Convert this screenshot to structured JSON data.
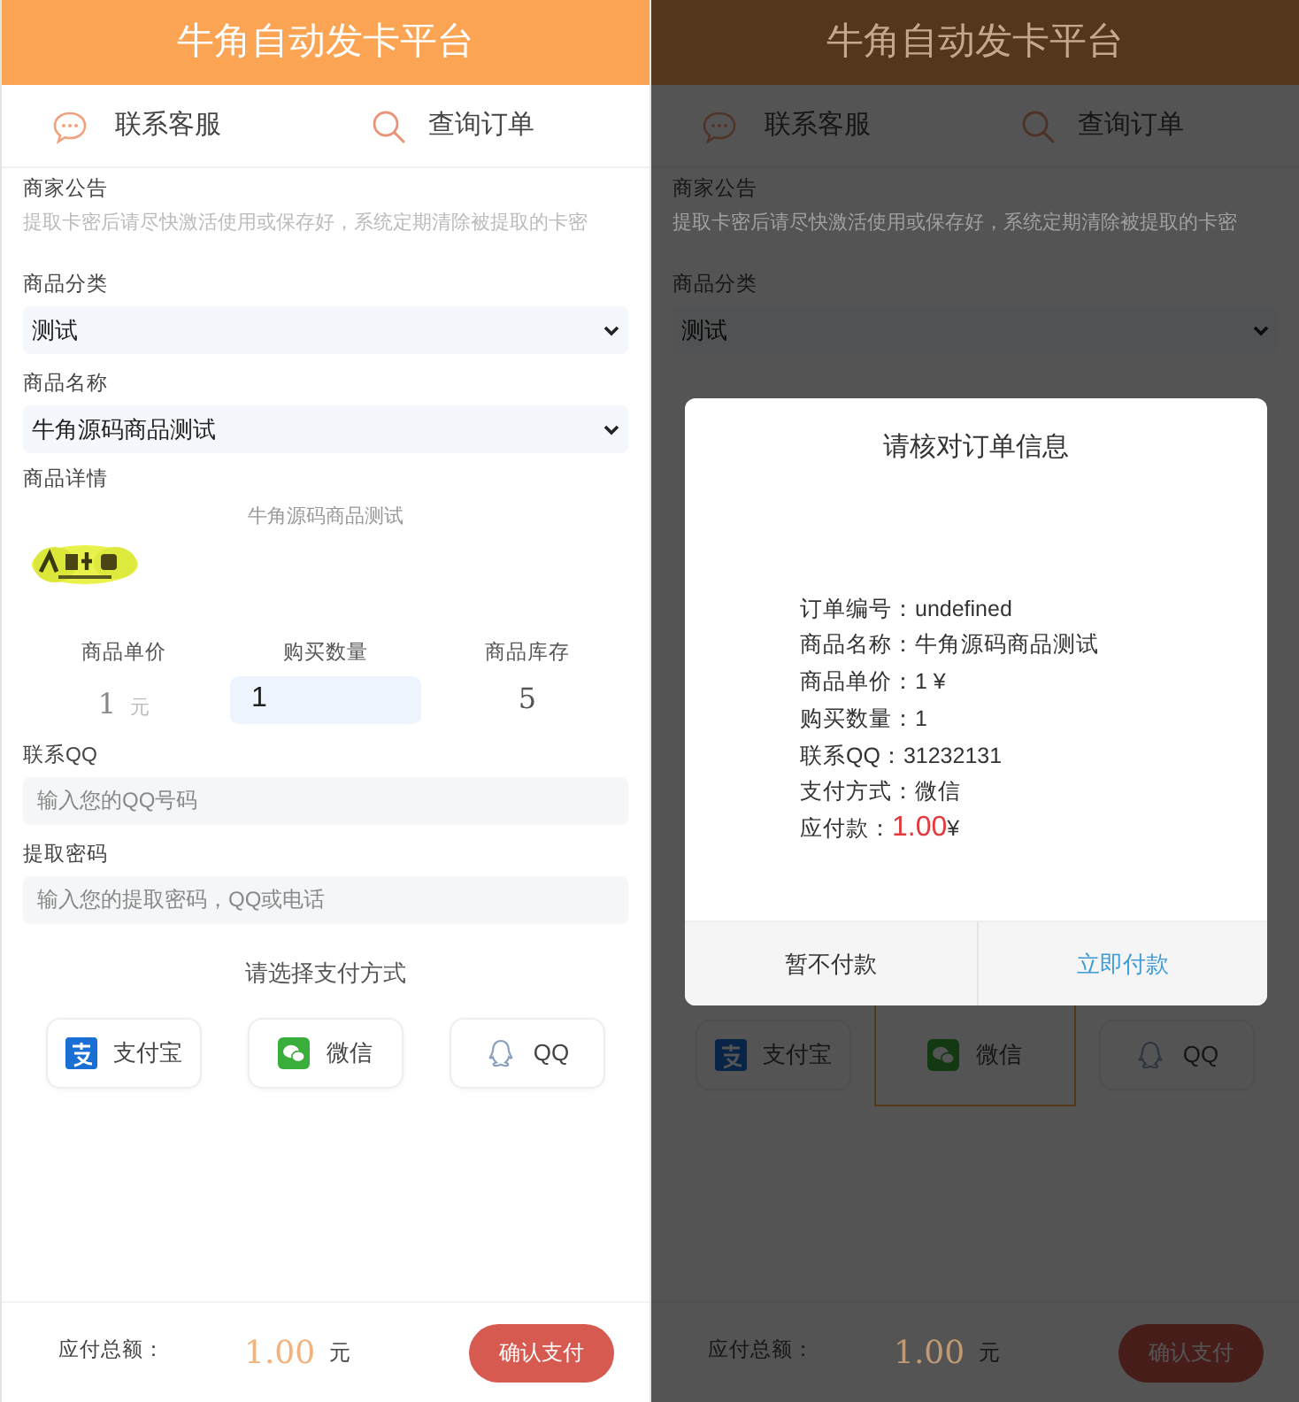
{
  "screens": [
    {
      "header": {
        "title": "牛角自动发卡平台"
      },
      "nav": [
        {
          "label": "联系客服",
          "kind": "chat"
        },
        {
          "label": "查询订单",
          "kind": "search"
        }
      ],
      "notice": {
        "label": "商家公告",
        "text": "提取卡密后请尽快激活使用或保存好，系统定期清除被提取的卡密"
      },
      "category": {
        "label": "商品分类",
        "value": "测试"
      },
      "product": {
        "label": "商品名称",
        "value": "牛角源码商品测试"
      },
      "detail": {
        "label": "商品详情",
        "text": "牛角源码商品测试"
      },
      "stats": {
        "price_label": "商品单价",
        "price": "1",
        "price_unit": "元",
        "quantity_label": "购买数量",
        "quantity": "1",
        "stock_label": "商品库存",
        "stock": "5"
      },
      "qq": {
        "label": "联系QQ",
        "placeholder": "输入您的QQ号码"
      },
      "password": {
        "label": "提取密码",
        "placeholder": "输入您的提取密码，QQ或电话"
      },
      "payment_prompt": "请选择支付方式",
      "payment_methods": [
        {
          "label": "支付宝",
          "kind": "alipay",
          "selected": false
        },
        {
          "label": "微信",
          "kind": "wechat",
          "selected": false
        },
        {
          "label": "QQ",
          "kind": "qq",
          "selected": false
        }
      ],
      "total": {
        "label": "应付总额：",
        "amount": "1.00",
        "unit": "元"
      },
      "confirm_button": "确认支付"
    },
    {
      "header": {
        "title": "牛角自动发卡平台"
      },
      "nav": [
        {
          "label": "联系客服",
          "kind": "chat"
        },
        {
          "label": "查询订单",
          "kind": "search"
        }
      ],
      "notice": {
        "label": "商家公告",
        "text": "提取卡密后请尽快激活使用或保存好，系统定期清除被提取的卡密"
      },
      "category": {
        "label": "商品分类",
        "value": "测试"
      },
      "payment_methods": [
        {
          "label": "支付宝",
          "kind": "alipay",
          "selected": false
        },
        {
          "label": "微信",
          "kind": "wechat",
          "selected": true
        },
        {
          "label": "QQ",
          "kind": "qq",
          "selected": false
        }
      ],
      "total": {
        "label": "应付总额：",
        "amount": "1.00",
        "unit": "元"
      },
      "confirm_button": "确认支付",
      "modal": {
        "title": "请核对订单信息",
        "lines": [
          "订单编号：undefined",
          "商品名称：牛角源码商品测试",
          "商品单价：1 ¥",
          "购买数量：1",
          "联系QQ：31232131",
          "支付方式：微信"
        ],
        "amount": {
          "label": "应付款：",
          "value": "1.00",
          "currency": "¥"
        },
        "buttons": [
          {
            "label": "暂不付款",
            "kind": "cancel"
          },
          {
            "label": "立即付款",
            "kind": "primary"
          }
        ]
      }
    }
  ]
}
